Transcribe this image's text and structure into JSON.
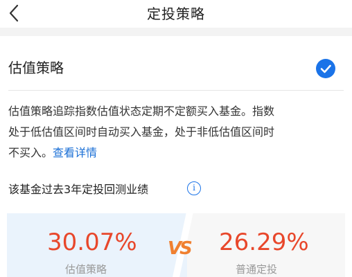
{
  "header": {
    "title": "定投策略",
    "back_icon": "chevron-left-icon"
  },
  "strategy": {
    "name": "估值策略",
    "selected": true,
    "check_icon": "check-circle-icon",
    "accent_color": "#1a73e8"
  },
  "description": {
    "line1": "估值策略追踪指数估值状态定期不定额买入基金。指数",
    "line2": "处于低估值区间时自动买入基金，处于非低估值区间时",
    "line3": "不买入。",
    "link": "查看详情"
  },
  "performance": {
    "title": "该基金过去3年定投回测业绩",
    "info_icon": "info-icon",
    "info_glyph": "i",
    "left_value": "30.07%",
    "left_label": "估值策略",
    "vs": "VS",
    "right_value": "26.29%",
    "right_label": "普通定投",
    "value_color": "#e8472b"
  }
}
